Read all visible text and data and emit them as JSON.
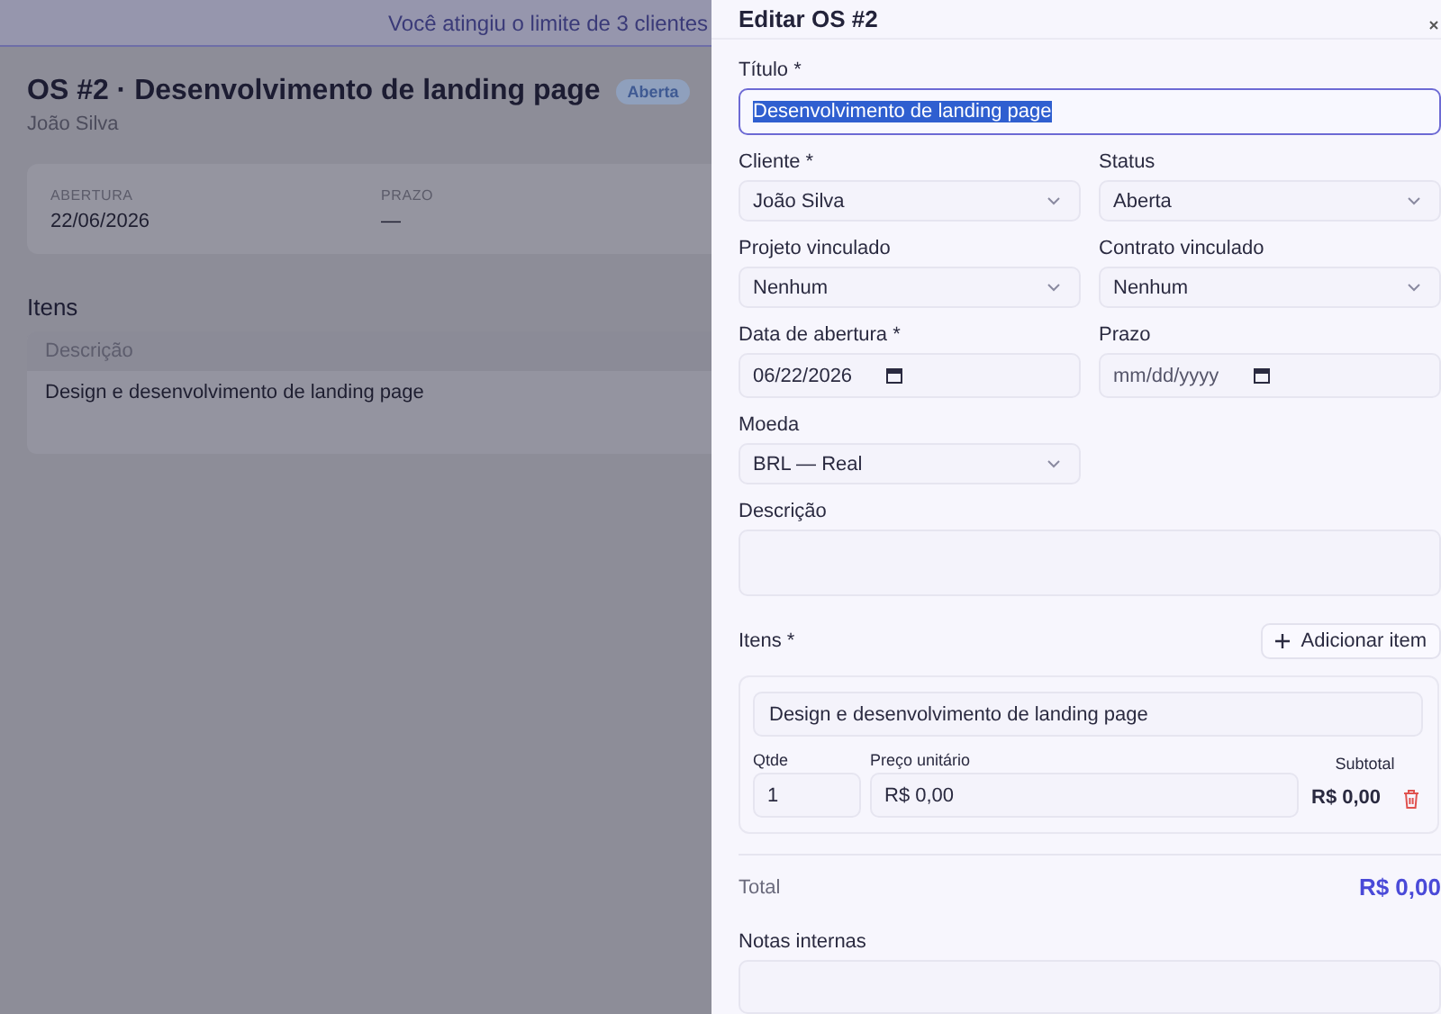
{
  "banner": {
    "text": "Você atingiu o limite de 3 clientes"
  },
  "page": {
    "title": "OS #2 · Desenvolvimento de landing page",
    "status_badge": "Aberta",
    "client": "João Silva",
    "summary": [
      {
        "label": "ABERTURA",
        "value": "22/06/2026"
      },
      {
        "label": "PRAZO",
        "value": "—"
      }
    ],
    "items_heading": "Itens",
    "items_table": {
      "columns": [
        "Descrição"
      ],
      "rows": [
        [
          "Design e desenvolvimento de landing page"
        ]
      ]
    }
  },
  "drawer": {
    "title": "Editar OS #2",
    "rows": [
      [
        {
          "kind": "text",
          "label": "Título *",
          "value": "Desenvolvimento de landing page",
          "focused": true
        }
      ],
      [
        {
          "kind": "select",
          "label": "Cliente *",
          "value": "João Silva"
        },
        {
          "kind": "select",
          "label": "Status",
          "value": "Aberta"
        }
      ],
      [
        {
          "kind": "select",
          "label": "Projeto vinculado",
          "value": "Nenhum"
        },
        {
          "kind": "select",
          "label": "Contrato vinculado",
          "value": "Nenhum"
        }
      ],
      [
        {
          "kind": "date",
          "label": "Data de abertura *",
          "value": "06/22/2026"
        },
        {
          "kind": "date",
          "label": "Prazo",
          "placeholder": "mm/dd/yyyy"
        }
      ],
      [
        {
          "kind": "select",
          "label": "Moeda",
          "value": "BRL — Real"
        }
      ],
      [
        {
          "kind": "textarea",
          "label": "Descrição"
        }
      ]
    ],
    "items": {
      "label": "Itens *",
      "add_button": "Adicionar item",
      "entries": [
        {
          "description": "Design e desenvolvimento de landing page",
          "qty_label": "Qtde",
          "qty": "1",
          "price_label": "Preço unitário",
          "price": "R$ 0,00",
          "subtotal_label": "Subtotal",
          "subtotal": "R$ 0,00"
        }
      ]
    },
    "total": {
      "label": "Total",
      "value": "R$ 0,00"
    },
    "notes": {
      "label": "Notas internas"
    }
  }
}
